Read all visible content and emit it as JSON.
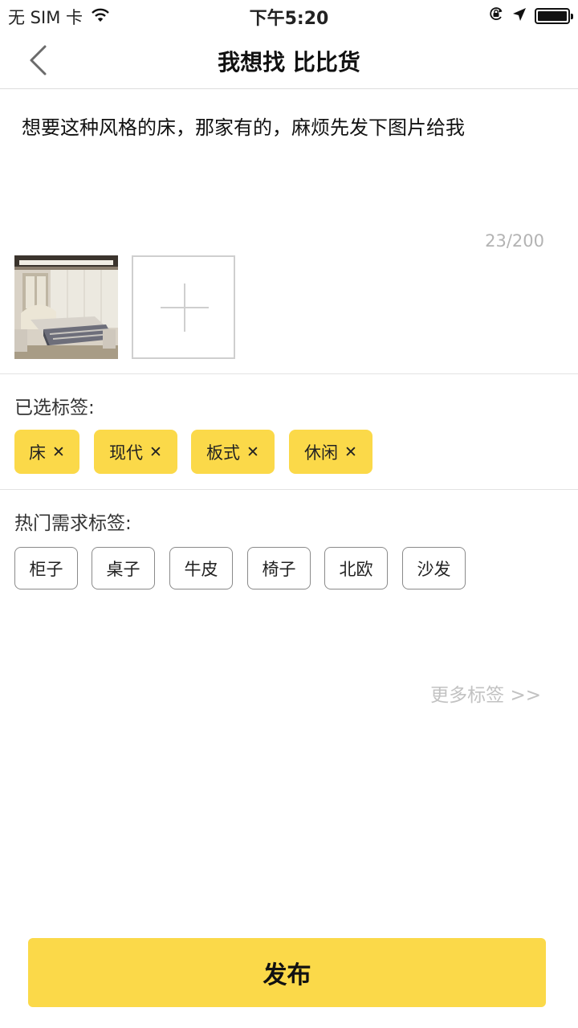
{
  "status_bar": {
    "carrier": "无 SIM 卡",
    "time": "下午5:20",
    "icons": [
      "wifi-icon",
      "orientation-lock-icon",
      "location-icon",
      "battery-icon"
    ],
    "battery_level": 1.0
  },
  "nav": {
    "back_icon": "chevron-left-icon",
    "title": "我想找 比比货"
  },
  "request": {
    "text": "想要这种风格的床，那家有的，麻烦先发下图片给我",
    "counter": "23/200"
  },
  "photos": {
    "add_icon": "plus-icon"
  },
  "selected_tags": {
    "label": "已选标签:",
    "remove_glyph": "✕",
    "items": [
      "床",
      "现代",
      "板式",
      "休闲"
    ]
  },
  "hot_tags": {
    "label": "热门需求标签:",
    "items": [
      "柜子",
      "桌子",
      "牛皮",
      "椅子",
      "北欧",
      "沙发"
    ]
  },
  "more_tags": "更多标签 >>",
  "publish_button": "发布",
  "colors": {
    "accent": "#fbd949",
    "counter_text": "#b3b3b3",
    "more_link": "#c2c2c2"
  }
}
